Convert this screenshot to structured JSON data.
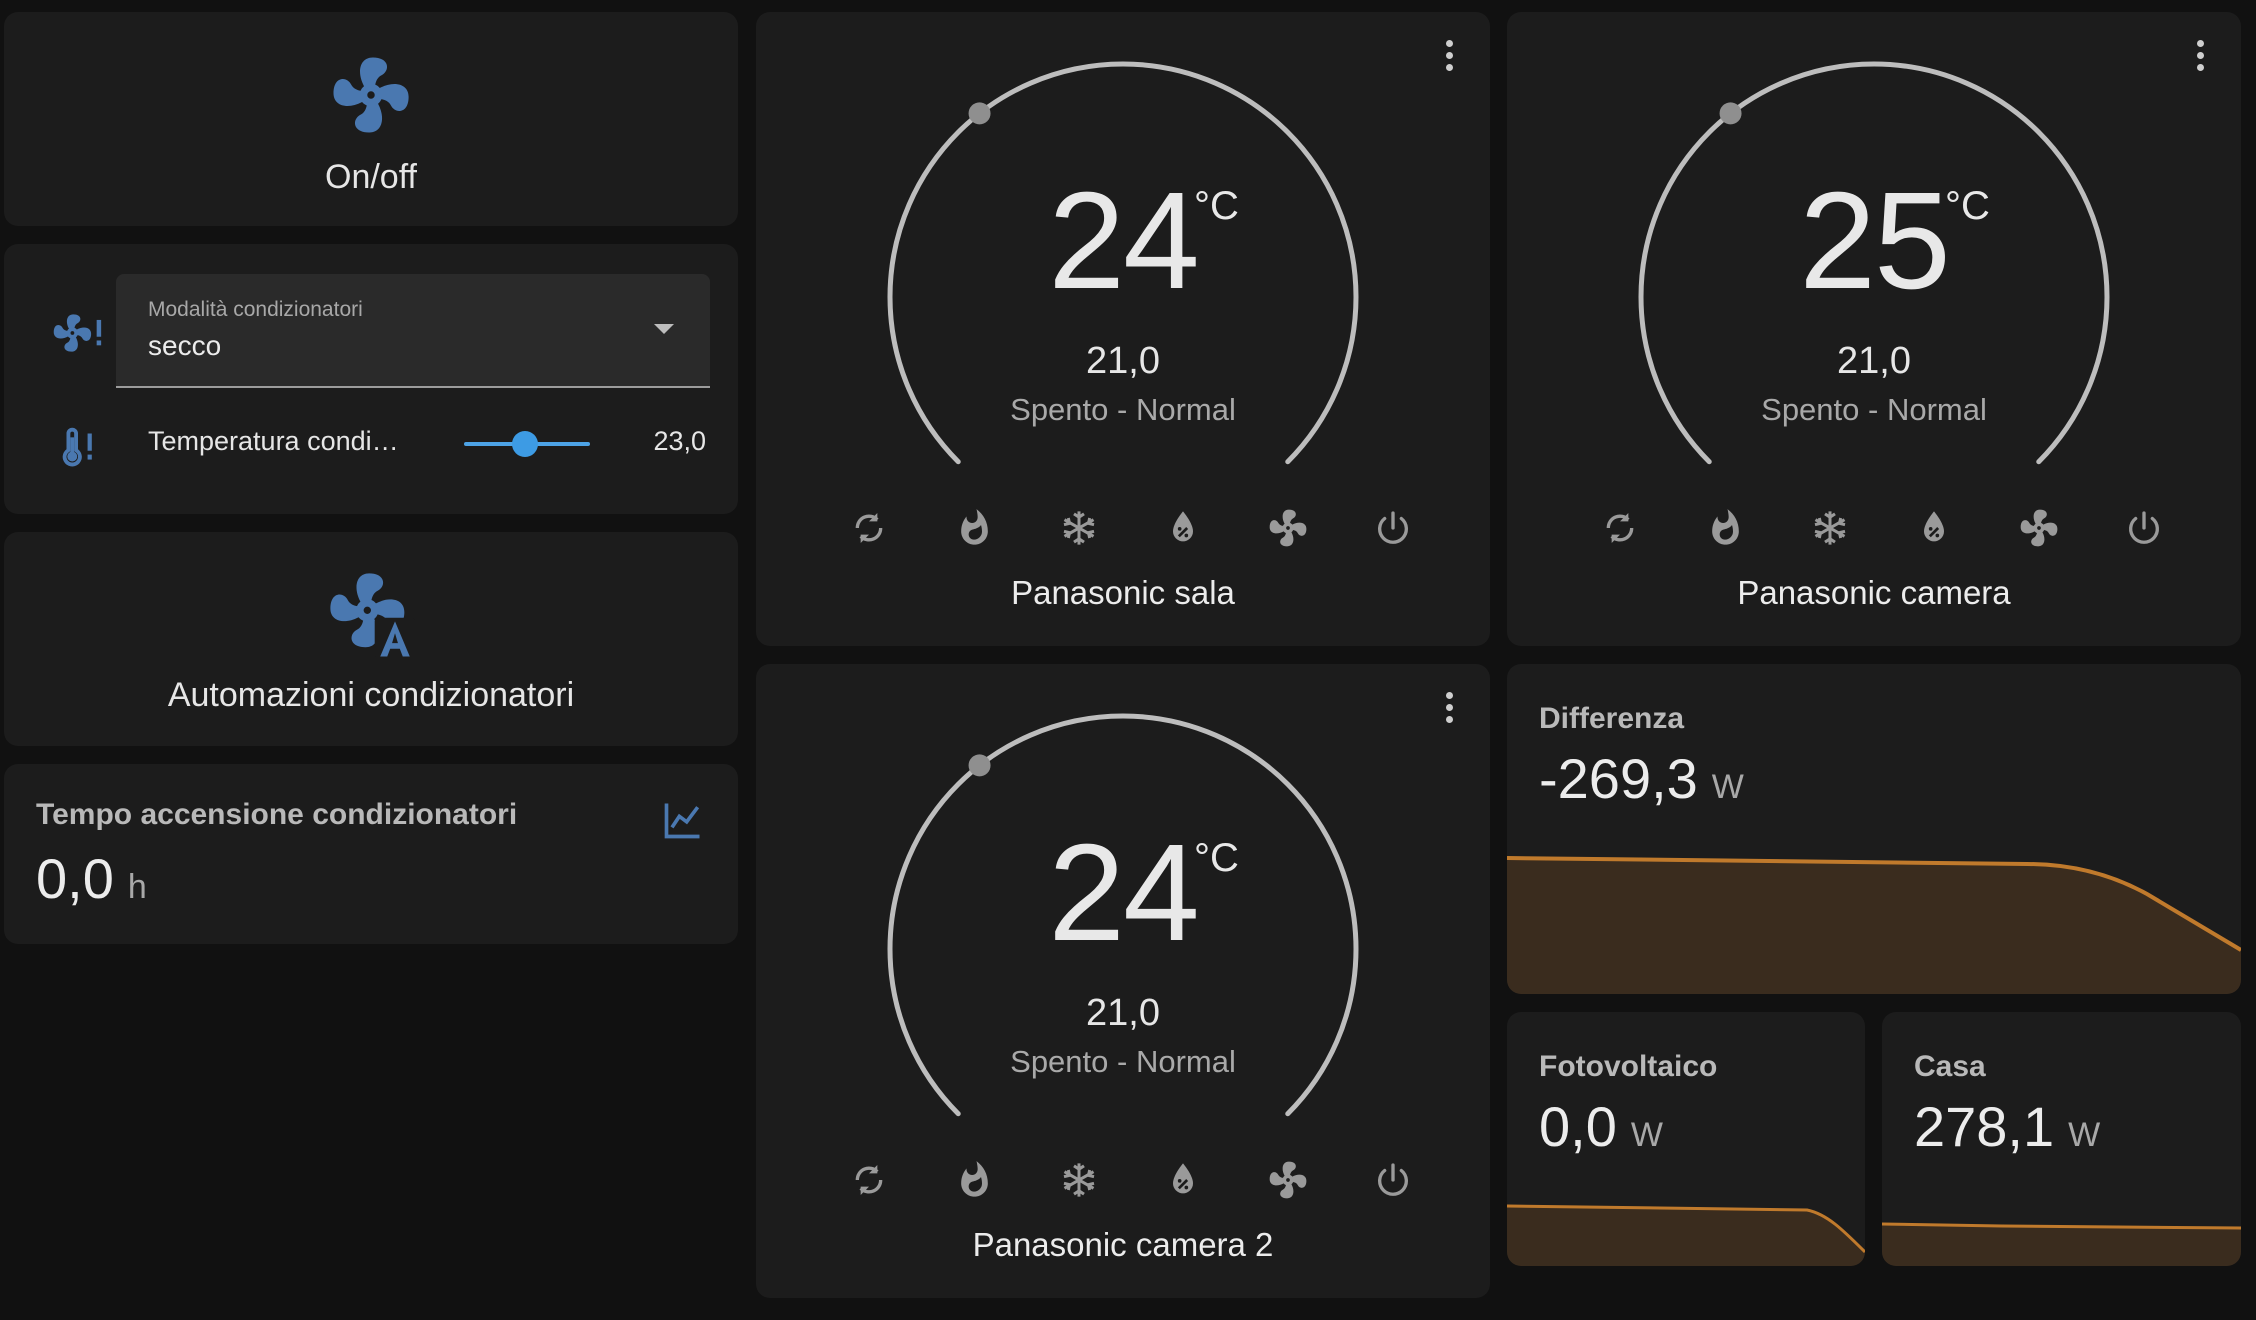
{
  "onoff": {
    "name": "On/off",
    "icon": "fan-icon",
    "icon_color": "#4a78b0"
  },
  "modes_card": {
    "select": {
      "label": "Modalità condizionatori",
      "value": "secco",
      "icon": "fan-alert-icon"
    },
    "slider": {
      "name": "Temperatura condi…",
      "value": "23,0",
      "level": 0.5,
      "icon": "thermometer-alert-icon"
    }
  },
  "automation": {
    "name": "Automazioni condizionatori",
    "icon": "fan-auto-icon"
  },
  "tempo": {
    "name": "Tempo accensione condizionatori",
    "value": "0,0",
    "unit": "h",
    "icon": "chart-line-icon"
  },
  "thermostats": [
    {
      "name": "Panasonic sala",
      "target": "24",
      "unit": "°C",
      "current": "21,0",
      "state": "Spento - Normal"
    },
    {
      "name": "Panasonic camera",
      "target": "25",
      "unit": "°C",
      "current": "21,0",
      "state": "Spento - Normal"
    },
    {
      "name": "Panasonic camera 2",
      "target": "24",
      "unit": "°C",
      "current": "21,0",
      "state": "Spento - Normal"
    }
  ],
  "hvac_modes": [
    "auto-icon",
    "heat-icon",
    "cool-icon",
    "dry-icon",
    "fan-only-icon",
    "power-icon"
  ],
  "energy": [
    {
      "name": "Differenza",
      "value": "-269,3",
      "unit": "W"
    },
    {
      "name": "Fotovoltaico",
      "value": "0,0",
      "unit": "W"
    },
    {
      "name": "Casa",
      "value": "278,1",
      "unit": "W"
    }
  ],
  "colors": {
    "accent": "#4a78b0",
    "slider": "#3d9be4",
    "graph_line": "#c07a2c",
    "graph_fill": "#3a2c1e"
  }
}
